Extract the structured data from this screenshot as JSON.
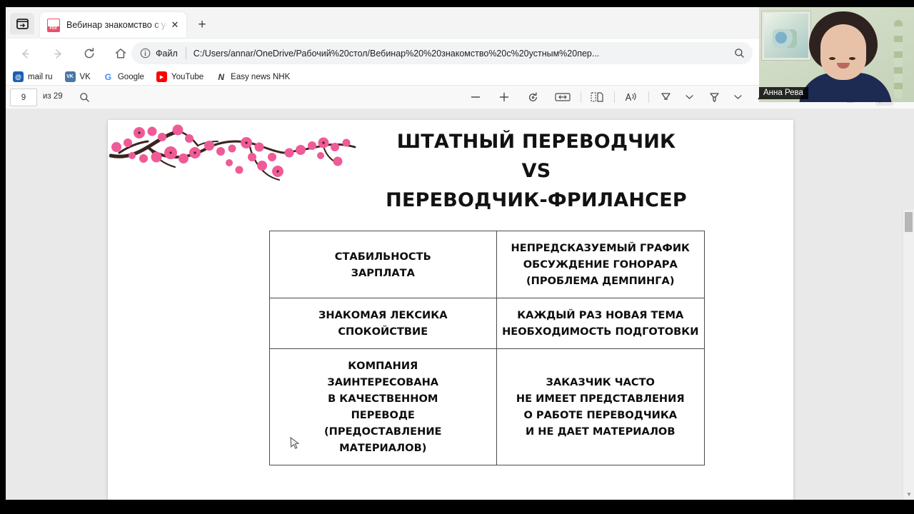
{
  "browser": {
    "tab": {
      "title": "Вебинар знакомство с устным ",
      "favicon_label": "PDF",
      "favicon_name": "pdf-file-icon",
      "close_glyph": "✕"
    },
    "new_tab_glyph": "+",
    "nav": {
      "back_glyph": "←",
      "forward_glyph": "→",
      "reload_glyph": "⟳",
      "home_glyph": "⌂"
    },
    "omnibox": {
      "info_glyph": "ⓘ",
      "scheme_label": "Файл",
      "url": "C:/Users/annar/OneDrive/Рабочий%20стол/Вебинар%20%20знакомство%20с%20устным%20пер...",
      "zoom_glyph": "⌕"
    },
    "bookmarks": [
      {
        "label": "mail ru",
        "icon": "@",
        "color": "#1b5fb4"
      },
      {
        "label": "VK",
        "icon": "VK",
        "color": "#4a76a8"
      },
      {
        "label": "Google",
        "icon": "G",
        "color": "#ffffff"
      },
      {
        "label": "YouTube",
        "icon": "▶",
        "color": "#ff0000"
      },
      {
        "label": "Easy news NHK",
        "icon": "N",
        "color": "#ffffff"
      }
    ]
  },
  "pdf_toolbar": {
    "current_page": "9",
    "page_total_label": "из 29",
    "search_glyph": "⌕",
    "zoom_out_glyph": "−",
    "zoom_in_glyph": "+",
    "rotate_glyph": "↻",
    "fit_glyph": "↔",
    "layout_glyph": "▯",
    "read_aloud_glyph": "A",
    "draw_glyph": "✒",
    "highlight_glyph": "🖊",
    "erase_glyph": "◇",
    "print_glyph": "🖨",
    "save_glyph": "▭",
    "notes_glyph": "🗒",
    "pin_glyph": "📌",
    "chevron_glyph": "⌄"
  },
  "slide": {
    "title_lines": [
      "ШТАТНЫЙ ПЕРЕВОДЧИК",
      "VS",
      "ПЕРЕВОДЧИК-ФРИЛАНСЕР"
    ],
    "decoration": "sakura-branch",
    "table": {
      "rows": [
        {
          "left": [
            "СТАБИЛЬНОСТЬ",
            "ЗАРПЛАТА"
          ],
          "right": [
            "НЕПРЕДСКАЗУЕМЫЙ ГРАФИК",
            "ОБСУЖДЕНИЕ ГОНОРАРА",
            "(ПРОБЛЕМА ДЕМПИНГА)"
          ]
        },
        {
          "left": [
            "ЗНАКОМАЯ ЛЕКСИКА",
            "СПОКОЙСТВИЕ"
          ],
          "right": [
            "КАЖДЫЙ РАЗ НОВАЯ ТЕМА",
            "НЕОБХОДИМОСТЬ ПОДГОТОВКИ"
          ]
        },
        {
          "left": [
            "КОМПАНИЯ",
            "ЗАИНТЕРЕСОВАНА",
            "В КАЧЕСТВЕННОМ",
            "ПЕРЕВОДЕ",
            "(ПРЕДОСТАВЛЕНИЕ",
            "МАТЕРИАЛОВ)"
          ],
          "right": [
            "ЗАКАЗЧИК ЧАСТО",
            "НЕ ИМЕЕТ ПРЕДСТАВЛЕНИЯ",
            "О РАБОТЕ ПЕРЕВОДЧИКА",
            "И НЕ ДАЕТ МАТЕРИАЛОВ"
          ]
        }
      ]
    }
  },
  "webcam": {
    "name": "Анна Рева"
  }
}
